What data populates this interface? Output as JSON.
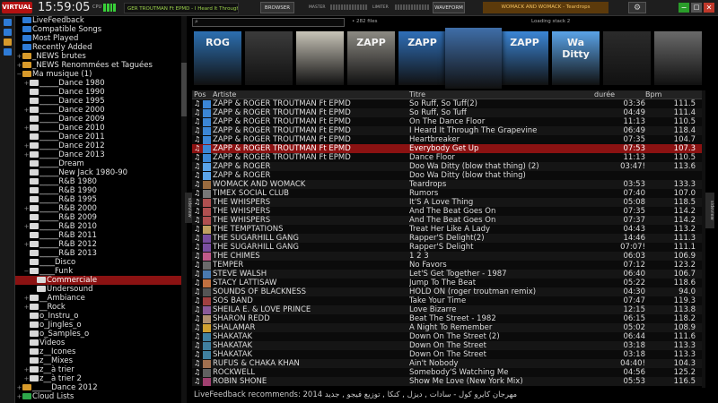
{
  "topbar": {
    "logo": "VIRTUAL DJ",
    "clock": "15:59:05",
    "cpu_label": "CPU",
    "now_playing": "GER TROUTMAN Ft EPMD - I Heard It Through The G",
    "browser_label": "BROWSER",
    "master_label": "MASTER",
    "limiter_label": "LIMITER",
    "waveform_label": "WAVEFORM",
    "deck_title": "WOMACK AND WOMACK - Teardrops",
    "settings_icon": "gear-icon",
    "minimize": "−",
    "maximize": "□",
    "close": "✕"
  },
  "search": {
    "value": "",
    "file_count": "• 282 files",
    "loading": "Loading stack 2"
  },
  "covers": [
    {
      "text": "ROG",
      "color": "#2c6fb0"
    },
    {
      "text": "",
      "color": "#3b3b3b"
    },
    {
      "text": "",
      "color": "#c8c4b8"
    },
    {
      "text": "ZAPP",
      "color": "#8c8a83"
    },
    {
      "text": "ZAPP",
      "color": "#2f6fb8"
    },
    {
      "text": "",
      "color": "#3f6ea8"
    },
    {
      "text": "ZAPP",
      "color": "#3b86d6"
    },
    {
      "text": "Wa Ditty",
      "color": "#5aa3e8"
    },
    {
      "text": "",
      "color": "#2b2b2b"
    },
    {
      "text": "",
      "color": "#6a6a6a"
    }
  ],
  "sidebar": {
    "icons": [
      {
        "name": "filter-icon",
        "color": "#2e7bd6"
      },
      {
        "name": "playlist-icon",
        "color": "#2e7bd6"
      },
      {
        "name": "folder-icon",
        "color": "#d79a2b"
      },
      {
        "name": "history-icon",
        "color": "#2e7bd6"
      }
    ],
    "tree": [
      {
        "label": "LiveFeedback",
        "exp": "",
        "indent": 0,
        "icon": "#2e7bd6"
      },
      {
        "label": "Compatible Songs",
        "exp": "",
        "indent": 0,
        "icon": "#2e7bd6"
      },
      {
        "label": "Most Played",
        "exp": "",
        "indent": 0,
        "icon": "#2e7bd6"
      },
      {
        "label": "Recently Added",
        "exp": "",
        "indent": 0,
        "icon": "#2e7bd6"
      },
      {
        "label": "_NEWS brutes",
        "exp": "+",
        "indent": 0,
        "icon": "#d79a2b"
      },
      {
        "label": "_NEWS Renommées et Taguées",
        "exp": "+",
        "indent": 0,
        "icon": "#d79a2b"
      },
      {
        "label": "Ma musique (1)",
        "exp": "−",
        "indent": 0,
        "icon": "#d79a2b"
      },
      {
        "label": "_____Dance 1980",
        "exp": "+",
        "indent": 1,
        "icon": "#d9d9d9"
      },
      {
        "label": "_____Dance 1990",
        "exp": "",
        "indent": 1,
        "icon": "#d9d9d9"
      },
      {
        "label": "_____Dance 1995",
        "exp": "",
        "indent": 1,
        "icon": "#d9d9d9"
      },
      {
        "label": "_____Dance 2000",
        "exp": "+",
        "indent": 1,
        "icon": "#d9d9d9"
      },
      {
        "label": "_____Dance 2009",
        "exp": "",
        "indent": 1,
        "icon": "#d9d9d9"
      },
      {
        "label": "_____Dance 2010",
        "exp": "+",
        "indent": 1,
        "icon": "#d9d9d9"
      },
      {
        "label": "_____Dance 2011",
        "exp": "",
        "indent": 1,
        "icon": "#d9d9d9"
      },
      {
        "label": "_____Dance 2012",
        "exp": "+",
        "indent": 1,
        "icon": "#d9d9d9"
      },
      {
        "label": "_____Dance 2013",
        "exp": "+",
        "indent": 1,
        "icon": "#d9d9d9"
      },
      {
        "label": "_____Dream",
        "exp": "",
        "indent": 1,
        "icon": "#d9d9d9"
      },
      {
        "label": "_____New Jack 1980-90",
        "exp": "",
        "indent": 1,
        "icon": "#d9d9d9"
      },
      {
        "label": "_____R&B 1980",
        "exp": "",
        "indent": 1,
        "icon": "#d9d9d9"
      },
      {
        "label": "_____R&B 1990",
        "exp": "",
        "indent": 1,
        "icon": "#d9d9d9"
      },
      {
        "label": "_____R&B 1995",
        "exp": "",
        "indent": 1,
        "icon": "#d9d9d9"
      },
      {
        "label": "_____R&B 2000",
        "exp": "+",
        "indent": 1,
        "icon": "#d9d9d9"
      },
      {
        "label": "_____R&B 2009",
        "exp": "",
        "indent": 1,
        "icon": "#d9d9d9"
      },
      {
        "label": "_____R&B 2010",
        "exp": "+",
        "indent": 1,
        "icon": "#d9d9d9"
      },
      {
        "label": "_____R&B 2011",
        "exp": "",
        "indent": 1,
        "icon": "#d9d9d9"
      },
      {
        "label": "_____R&B 2012",
        "exp": "+",
        "indent": 1,
        "icon": "#d9d9d9"
      },
      {
        "label": "_____R&B 2013",
        "exp": "",
        "indent": 1,
        "icon": "#d9d9d9"
      },
      {
        "label": "____Disco",
        "exp": "",
        "indent": 1,
        "icon": "#d9d9d9"
      },
      {
        "label": "____Funk",
        "exp": "−",
        "indent": 1,
        "icon": "#d9d9d9"
      },
      {
        "label": "Commerciale",
        "exp": "",
        "indent": 2,
        "icon": "#d9d9d9",
        "selected": true
      },
      {
        "label": "Undersound",
        "exp": "",
        "indent": 2,
        "icon": "#d9d9d9"
      },
      {
        "label": "__Ambiance",
        "exp": "+",
        "indent": 1,
        "icon": "#d9d9d9"
      },
      {
        "label": "__Rock",
        "exp": "+",
        "indent": 1,
        "icon": "#d9d9d9"
      },
      {
        "label": "o_Instru_o",
        "exp": "",
        "indent": 1,
        "icon": "#d9d9d9"
      },
      {
        "label": "o_Jingles_o",
        "exp": "",
        "indent": 1,
        "icon": "#d9d9d9"
      },
      {
        "label": "o_Samples_o",
        "exp": "",
        "indent": 1,
        "icon": "#d9d9d9"
      },
      {
        "label": "Videos",
        "exp": "",
        "indent": 1,
        "icon": "#d9d9d9"
      },
      {
        "label": "z__Icones",
        "exp": "",
        "indent": 1,
        "icon": "#d9d9d9"
      },
      {
        "label": "z__Mixes",
        "exp": "",
        "indent": 1,
        "icon": "#d9d9d9"
      },
      {
        "label": "z__à trier",
        "exp": "+",
        "indent": 1,
        "icon": "#d9d9d9"
      },
      {
        "label": "z__à trier 2",
        "exp": "+",
        "indent": 1,
        "icon": "#d9d9d9"
      },
      {
        "label": "_____Dance 2012",
        "exp": "+",
        "indent": 0,
        "icon": "#d79a2b"
      },
      {
        "label": "Cloud Lists",
        "exp": "+",
        "indent": 0,
        "icon": "#2ea84a"
      }
    ]
  },
  "side_tabs": {
    "left": "sideview",
    "right": "sideview"
  },
  "table": {
    "headers": {
      "icon": "Pos",
      "artist": "Artiste",
      "title": "Titre",
      "duration": "durée",
      "bpm": "Bpm"
    },
    "rows": [
      {
        "artist": "ZAPP & ROGER TROUTMAN Ft EPMD",
        "title": "So Ruff, So Tuff(2)",
        "duration": "03:36",
        "bpm": "111.5",
        "cover": "#3b86d6"
      },
      {
        "artist": "ZAPP & ROGER TROUTMAN Ft EPMD",
        "title": "So Ruff, So Tuff",
        "duration": "04:49",
        "bpm": "111.4",
        "cover": "#3b86d6"
      },
      {
        "artist": "ZAPP & ROGER TROUTMAN Ft EPMD",
        "title": "On The Dance Floor",
        "duration": "11:13",
        "bpm": "110.5",
        "cover": "#3b86d6"
      },
      {
        "artist": "ZAPP & ROGER TROUTMAN Ft EPMD",
        "title": "I Heard It Through The Grapevine",
        "duration": "06:49",
        "bpm": "118.4",
        "cover": "#3b86d6"
      },
      {
        "artist": "ZAPP & ROGER TROUTMAN Ft EPMD",
        "title": "Heartbreaker",
        "duration": "07:35",
        "bpm": "104.7",
        "cover": "#3b86d6"
      },
      {
        "artist": "ZAPP & ROGER TROUTMAN Ft EPMD",
        "title": "Everybody Get Up",
        "duration": "07:53",
        "bpm": "107.3",
        "cover": "#3b86d6",
        "playing": true
      },
      {
        "artist": "ZAPP & ROGER TROUTMAN Ft EPMD",
        "title": "Dance Floor",
        "duration": "11:13",
        "bpm": "110.5",
        "cover": "#3b86d6"
      },
      {
        "artist": "ZAPP & ROGER",
        "title": "Doo Wa Ditty (blow that thing) (2)",
        "duration": "03:47!",
        "bpm": "113.6",
        "cover": "#5aa3e8"
      },
      {
        "artist": "ZAPP & ROGER",
        "title": "Doo Wa Ditty (blow that thing)",
        "duration": "",
        "bpm": "",
        "cover": "#5aa3e8"
      },
      {
        "artist": "WOMACK AND WOMACK",
        "title": "Teardrops",
        "duration": "03:53",
        "bpm": "133.3",
        "cover": "#9a6b3f"
      },
      {
        "artist": "TIMEX SOCIAL CLUB",
        "title": "Rumors",
        "duration": "07:40",
        "bpm": "107.0",
        "cover": "#777"
      },
      {
        "artist": "THE WHISPERS",
        "title": "It'S A Love Thing",
        "duration": "05:08",
        "bpm": "118.5",
        "cover": "#b05050"
      },
      {
        "artist": "THE WHISPERS",
        "title": "And The Beat Goes On",
        "duration": "07:35",
        "bpm": "114.2",
        "cover": "#b05050"
      },
      {
        "artist": "THE WHISPERS",
        "title": "And The Beat Goes On",
        "duration": "07:37",
        "bpm": "114.2",
        "cover": "#b05050"
      },
      {
        "artist": "THE TEMPTATIONS",
        "title": "Treat Her Like A Lady",
        "duration": "04:43",
        "bpm": "113.2",
        "cover": "#c0a060"
      },
      {
        "artist": "THE SUGARHILL GANG",
        "title": "Rapper'S Delight(2)",
        "duration": "14:46",
        "bpm": "111.3",
        "cover": "#7a4ea0"
      },
      {
        "artist": "THE SUGARHILL GANG",
        "title": "Rapper'S Delight",
        "duration": "07:07!",
        "bpm": "111.1",
        "cover": "#7a4ea0"
      },
      {
        "artist": "THE CHIMES",
        "title": "1 2 3",
        "duration": "06:03",
        "bpm": "106.9",
        "cover": "#c05a8a"
      },
      {
        "artist": "TEMPER",
        "title": "No Favors",
        "duration": "07:12",
        "bpm": "123.2",
        "cover": "#6a6a6a"
      },
      {
        "artist": "STEVE WALSH",
        "title": "Let'S Get Together  -  1987",
        "duration": "06:40",
        "bpm": "106.7",
        "cover": "#4a7ab0"
      },
      {
        "artist": "STACY LATTISAW",
        "title": "Jump To The Beat",
        "duration": "05:22",
        "bpm": "118.6",
        "cover": "#c07040"
      },
      {
        "artist": "SOUNDS OF BLACKNESS",
        "title": "HOLD ON (roger troutman remix)",
        "duration": "04:30",
        "bpm": "94.0",
        "cover": "#555"
      },
      {
        "artist": "SOS BAND",
        "title": "Take Your Time",
        "duration": "07:47",
        "bpm": "119.3",
        "cover": "#a04040"
      },
      {
        "artist": "SHEILA E. & LOVE PRINCE",
        "title": "Love Bizarre",
        "duration": "12:15",
        "bpm": "113.8",
        "cover": "#8a5a9a"
      },
      {
        "artist": "SHARON REDD",
        "title": "Beat The Street  -  1982",
        "duration": "06:15",
        "bpm": "118.2",
        "cover": "#b09070"
      },
      {
        "artist": "SHALAMAR",
        "title": "A Night To Remember",
        "duration": "05:02",
        "bpm": "108.9",
        "cover": "#d0a030"
      },
      {
        "artist": "SHAKATAK",
        "title": "Down On The Street (2)",
        "duration": "06:44",
        "bpm": "111.6",
        "cover": "#4080a0"
      },
      {
        "artist": "SHAKATAK",
        "title": "Down On The Street",
        "duration": "03:18",
        "bpm": "113.3",
        "cover": "#4080a0"
      },
      {
        "artist": "SHAKATAK",
        "title": "Down On The Street",
        "duration": "03:18",
        "bpm": "113.3",
        "cover": "#4080a0"
      },
      {
        "artist": "RUFUS & CHAKA KHAN",
        "title": "Ain't Nobody",
        "duration": "04:40!",
        "bpm": "104.3",
        "cover": "#a07050"
      },
      {
        "artist": "ROCKWELL",
        "title": "Somebody'S Watching Me",
        "duration": "04:56",
        "bpm": "125.2",
        "cover": "#606060"
      },
      {
        "artist": "ROBIN SHONE",
        "title": "Show Me Love (New York Mix)",
        "duration": "05:53",
        "bpm": "116.5",
        "cover": "#a04070"
      }
    ]
  },
  "footer": {
    "text": "LiveFeedback recommends: 2014 مهرجان كايرو كول - سادات , ديزل , كنكا , توزيع فيجو , جديد"
  }
}
